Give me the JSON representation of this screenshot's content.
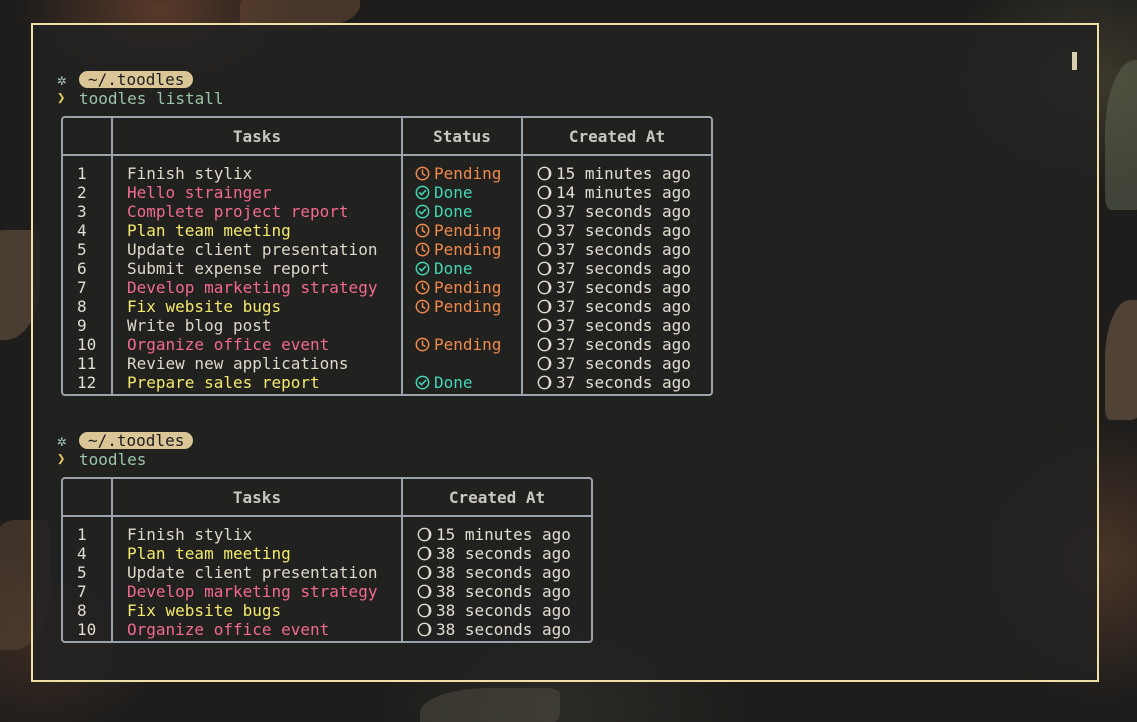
{
  "colors": {
    "border": "#efe0a6",
    "table_border": "#9aa3ab",
    "pending": "#f08a4b",
    "done": "#43d6b5",
    "task_white": "#dfd9c9",
    "task_pink": "#f26a8d",
    "task_yellow": "#f4ea6c",
    "dir_pill": "#d9c595",
    "command": "#9bc5a8"
  },
  "prompt1": {
    "dir": "~/.toodles",
    "command": "toodles listall"
  },
  "table1": {
    "headers": {
      "index": "",
      "tasks": "Tasks",
      "status": "Status",
      "created": "Created At"
    },
    "rows": [
      {
        "id": "1",
        "task": "Finish stylix",
        "color": "white",
        "status": "Pending",
        "created": "15 minutes ago"
      },
      {
        "id": "2",
        "task": "Hello strainger",
        "color": "pink",
        "status": "Done",
        "created": "14 minutes ago"
      },
      {
        "id": "3",
        "task": "Complete project report",
        "color": "pink",
        "status": "Done",
        "created": "37 seconds ago"
      },
      {
        "id": "4",
        "task": "Plan team meeting",
        "color": "yellow",
        "status": "Pending",
        "created": "37 seconds ago"
      },
      {
        "id": "5",
        "task": "Update client presentation",
        "color": "white",
        "status": "Pending",
        "created": "37 seconds ago"
      },
      {
        "id": "6",
        "task": "Submit expense report",
        "color": "white",
        "status": "Done",
        "created": "37 seconds ago"
      },
      {
        "id": "7",
        "task": "Develop marketing strategy",
        "color": "pink",
        "status": "Pending",
        "created": "37 seconds ago"
      },
      {
        "id": "8",
        "task": "Fix website bugs",
        "color": "yellow",
        "status": "Pending",
        "created": "37 seconds ago"
      },
      {
        "id": "9",
        "task": "Write blog post",
        "color": "white",
        "status": "",
        "created": "37 seconds ago"
      },
      {
        "id": "10",
        "task": "Organize office event",
        "color": "pink",
        "status": "Pending",
        "created": "37 seconds ago"
      },
      {
        "id": "11",
        "task": "Review new applications",
        "color": "white",
        "status": "",
        "created": "37 seconds ago"
      },
      {
        "id": "12",
        "task": "Prepare sales report",
        "color": "yellow",
        "status": "Done",
        "created": "37 seconds ago"
      }
    ]
  },
  "prompt2": {
    "dir": "~/.toodles",
    "command": "toodles"
  },
  "table2": {
    "headers": {
      "index": "",
      "tasks": "Tasks",
      "created": "Created At"
    },
    "rows": [
      {
        "id": "1",
        "task": "Finish stylix",
        "color": "white",
        "created": "15 minutes ago"
      },
      {
        "id": "4",
        "task": "Plan team meeting",
        "color": "yellow",
        "created": "38 seconds ago"
      },
      {
        "id": "5",
        "task": "Update client presentation",
        "color": "white",
        "created": "38 seconds ago"
      },
      {
        "id": "7",
        "task": "Develop marketing strategy",
        "color": "pink",
        "created": "38 seconds ago"
      },
      {
        "id": "8",
        "task": "Fix website bugs",
        "color": "yellow",
        "created": "38 seconds ago"
      },
      {
        "id": "10",
        "task": "Organize office event",
        "color": "pink",
        "created": "38 seconds ago"
      }
    ]
  }
}
